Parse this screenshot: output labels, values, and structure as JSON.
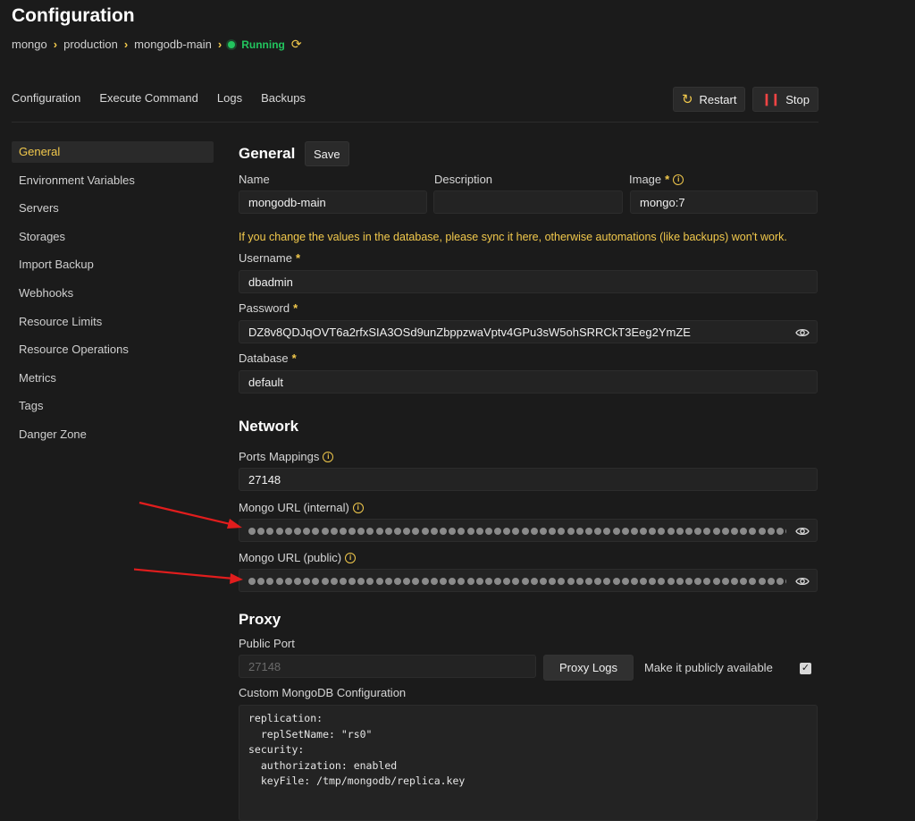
{
  "page": {
    "title": "Configuration"
  },
  "breadcrumb": {
    "items": [
      "mongo",
      "production",
      "mongodb-main"
    ],
    "status": "Running"
  },
  "tabs": [
    "Configuration",
    "Execute Command",
    "Logs",
    "Backups"
  ],
  "actions": {
    "restart": "Restart",
    "stop": "Stop"
  },
  "sidebar": {
    "items": [
      "General",
      "Environment Variables",
      "Servers",
      "Storages",
      "Import Backup",
      "Webhooks",
      "Resource Limits",
      "Resource Operations",
      "Metrics",
      "Tags",
      "Danger Zone"
    ],
    "active_index": 0
  },
  "general": {
    "heading": "General",
    "save_label": "Save",
    "name_label": "Name",
    "name_value": "mongodb-main",
    "description_label": "Description",
    "description_value": "",
    "image_label": "Image",
    "image_value": "mongo:7",
    "required_mark": "*",
    "warning": "If you change the values in the database, please sync it here, otherwise automations (like backups) won't work.",
    "username_label": "Username",
    "username_value": "dbadmin",
    "password_label": "Password",
    "password_value": "DZ8v8QDJqOVT6a2rfxSIA3OSd9unZbppzwaVptv4GPu3sW5ohSRRCkT3Eeg2YmZE",
    "database_label": "Database",
    "database_value": "default"
  },
  "network": {
    "heading": "Network",
    "ports_label": "Ports Mappings",
    "ports_value": "27148",
    "internal_url_label": "Mongo URL (internal)",
    "public_url_label": "Mongo URL (public)"
  },
  "proxy": {
    "heading": "Proxy",
    "public_port_label": "Public Port",
    "public_port_placeholder": "27148",
    "proxy_logs_label": "Proxy Logs",
    "public_toggle_label": "Make it publicly available",
    "public_toggle_checked": true,
    "custom_config_label": "Custom MongoDB Configuration",
    "custom_config_value": "replication:\n  replSetName: \"rs0\"\nsecurity:\n  authorization: enabled\n  keyFile: /tmp/mongodb/replica.key"
  },
  "colors": {
    "accent": "#f2c94c",
    "running": "#22c55e",
    "stop": "#ef4444",
    "annotation_arrow": "#e11d1d",
    "background": "#1b1b1b"
  },
  "icons": {
    "separator": "chevron-right-icon",
    "status": "status-dot-icon",
    "refresh": "refresh-icon",
    "restart": "restart-icon",
    "stop": "stop-icon",
    "info": "info-icon",
    "eye": "eye-icon",
    "check": "checkmark-icon"
  }
}
